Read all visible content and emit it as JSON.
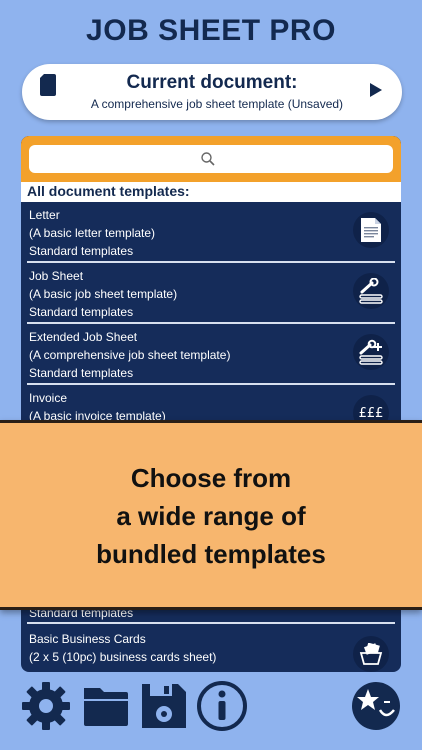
{
  "app": {
    "title": "JOB SHEET PRO"
  },
  "current_document": {
    "title": "Current document:",
    "subtitle": "A comprehensive job sheet template (Unsaved)"
  },
  "search": {
    "placeholder": ""
  },
  "templates": {
    "header": "All document templates:",
    "items": [
      {
        "name": "Letter",
        "description": "(A basic letter template)",
        "category": "Standard templates",
        "icon": "letter-icon"
      },
      {
        "name": "Job Sheet",
        "description": "(A basic job sheet template)",
        "category": "Standard templates",
        "icon": "wrench-icon"
      },
      {
        "name": "Extended Job Sheet",
        "description": "(A comprehensive job sheet template)",
        "category": "Standard templates",
        "icon": "wrench-plus-icon"
      },
      {
        "name": "Invoice",
        "description": "(A basic invoice template)",
        "category": "",
        "icon": "pound-icon"
      },
      {
        "name": "",
        "description": "",
        "category": "Standard templates",
        "icon": ""
      },
      {
        "name": "Basic Business Cards",
        "description": "(2 x 5 (10pc) business cards sheet)",
        "category": "",
        "icon": "cards-icon"
      }
    ]
  },
  "banner": {
    "line1": "Choose from",
    "line2": "a wide range of",
    "line3": "bundled templates"
  },
  "toolbar": {
    "items": [
      {
        "icon": "gear-icon"
      },
      {
        "icon": "folder-icon"
      },
      {
        "icon": "save-icon"
      },
      {
        "icon": "info-icon"
      },
      {
        "icon": "star-icon"
      }
    ]
  },
  "colors": {
    "background": "#8fb3ee",
    "navy": "#152c5a",
    "accent_orange": "#f3a12b",
    "banner": "#f7b66e"
  }
}
